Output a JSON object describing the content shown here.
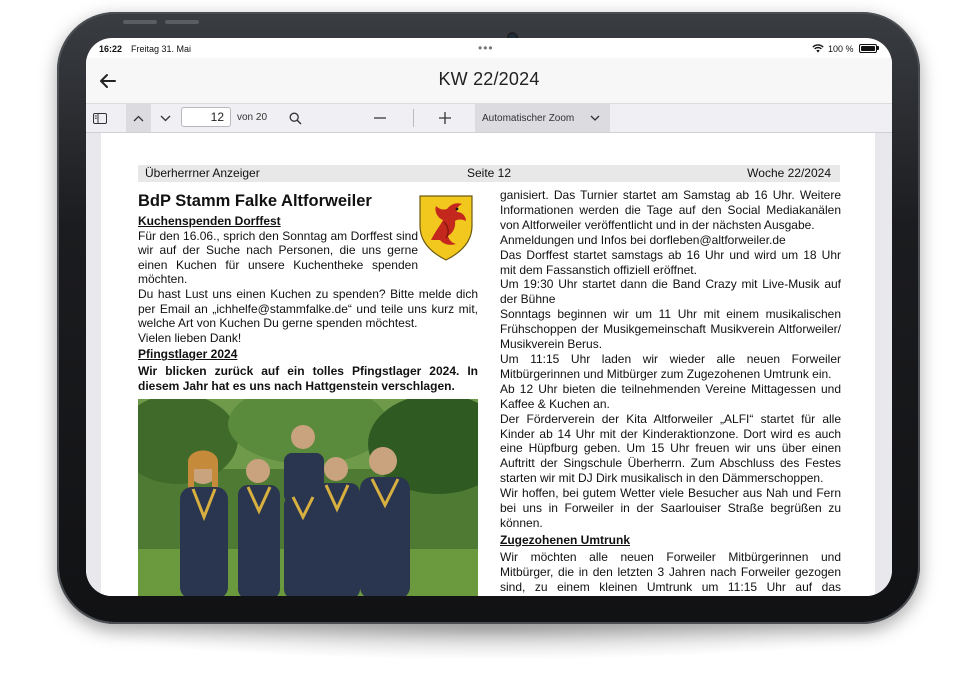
{
  "status": {
    "time": "16:22",
    "date": "Freitag 31. Mai",
    "dots": "•••",
    "battery": "100 %"
  },
  "nav": {
    "title": "KW 22/2024"
  },
  "toolbar": {
    "page_value": "12",
    "of_label": "von 20",
    "zoom_label": "Automatischer Zoom"
  },
  "page": {
    "header_left": "Überherrner Anzeiger",
    "header_center": "Seite 12",
    "header_right": "Woche 22/2024",
    "title": "BdP Stamm Falke Altforweiler",
    "sub1": "Kuchenspenden Dorffest",
    "p1": "Für den 16.06., sprich den Sonntag am Dorffest sind wir auf der Suche nach Personen, die uns gerne einen Kuchen für unsere Kuchentheke spenden möchten.",
    "p2": "Du hast Lust uns einen Kuchen zu spenden? Bitte melde dich per Email an „ichhelfe@stammfalke.de“ und teile uns kurz mit, welche Art von Kuchen Du gerne spenden möchtest.",
    "p3": "Vielen lieben Dank!",
    "sub2": "Pfingstlager 2024",
    "lead": "Wir blicken zurück auf ein tolles Pfingstlager 2024. In diesem Jahr hat es uns nach Hattgenstein verschlagen.",
    "r1": "ganisiert. Das Turnier startet am Samstag ab 16 Uhr. Weitere Informationen werden die Tage auf den Social Mediakanälen von Altforweiler veröffentlicht und in der nächsten Ausgabe.",
    "r2": "Anmeldungen und Infos bei dorfleben@altforweiler.de",
    "r3": "Das Dorffest startet samstags ab 16 Uhr und wird um 18 Uhr mit dem Fassanstich offiziell eröffnet.",
    "r4": "Um 19:30 Uhr startet dann die Band Crazy mit Live-Musik auf der Bühne",
    "r5": "Sonntags beginnen wir um 11 Uhr mit einem musikalischen Frühschoppen der Musikgemeinschaft Musikverein Altforweiler/ Musikverein Berus.",
    "r6": "Um 11:15 Uhr laden wir wieder alle neuen Forweiler Mitbürgerinnen und Mitbürger zum Zugezohenen Umtrunk ein.",
    "r7": "Ab 12 Uhr bieten die teilnehmenden Vereine Mittagessen und Kaffee & Kuchen an.",
    "r8": "Der Förderverein der Kita Altforweiler „ALFI“ startet für alle Kinder ab 14 Uhr mit der Kinderaktionzone. Dort wird es auch eine Hüpfburg geben. Um 15 Uhr freuen wir uns über einen Auftritt der Singschule Überherrn. Zum Abschluss des Festes starten wir mit DJ Dirk musikalisch in den Dämmerschoppen.",
    "r9": "Wir hoffen, bei gutem Wetter viele Besucher aus Nah und Fern bei uns in Forweiler in der Saarlouiser Straße begrüßen zu können.",
    "sub3": "Zugezohenen Umtrunk",
    "r10": "Wir möchten alle neuen Forweiler Mitbürgerinnen und Mitbürger, die in den letzten 3 Jahren nach Forweiler gezogen sind, zu einem kleinen Umtrunk um 11:15 Uhr auf das Festgelände einladen. Hier will sich die Möglichkeit ergeben, Kontakte knüpfen."
  }
}
